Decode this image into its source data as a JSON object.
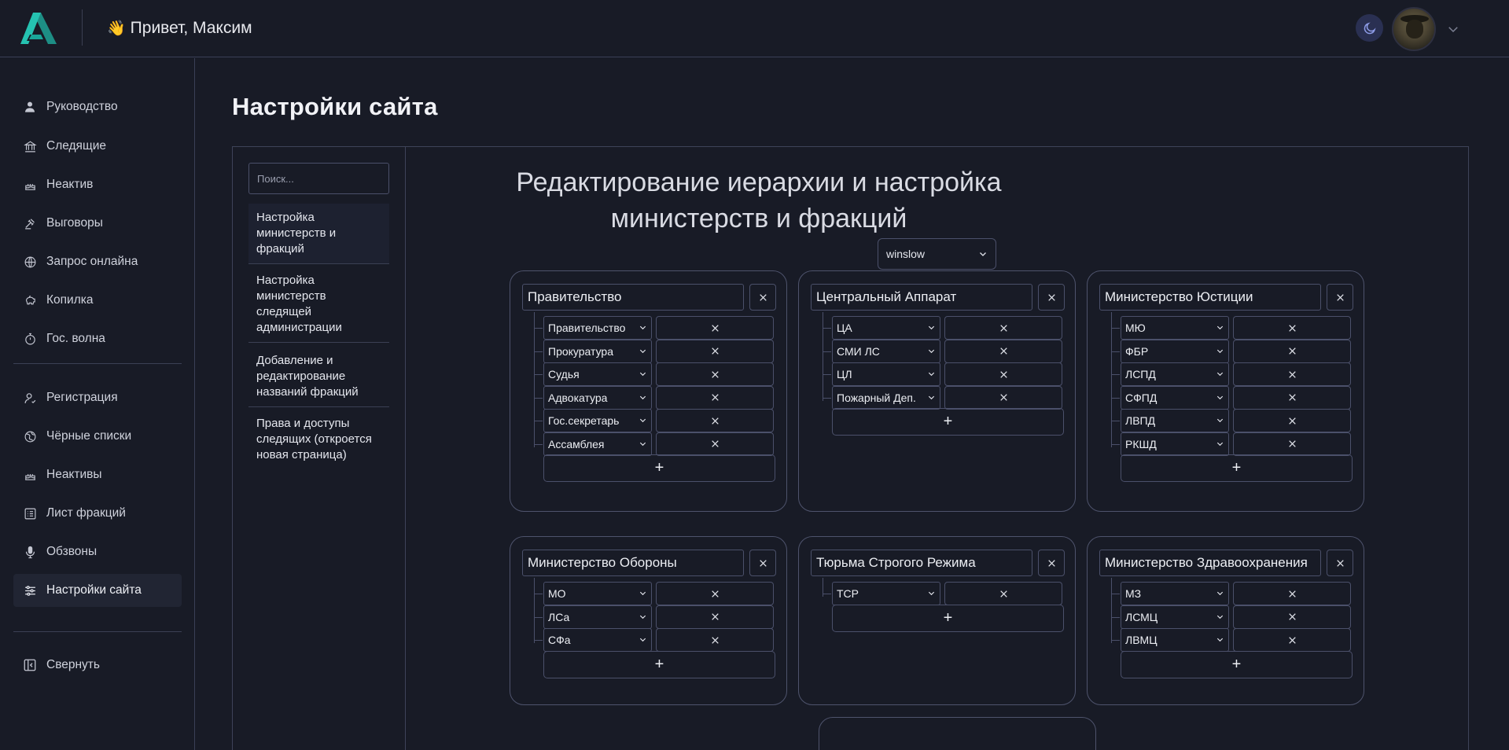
{
  "header": {
    "greeting_emoji": "👋",
    "greeting": "Привет, Максим"
  },
  "sidebar": {
    "group1": [
      {
        "label": "Руководство",
        "icon": "user-icon"
      },
      {
        "label": "Следящие",
        "icon": "bank-icon"
      },
      {
        "label": "Неактив",
        "icon": "cake-icon"
      },
      {
        "label": "Выговоры",
        "icon": "gavel-icon"
      },
      {
        "label": "Запрос онлайна",
        "icon": "globe-icon"
      },
      {
        "label": "Копилка",
        "icon": "piggy-bank-icon"
      },
      {
        "label": "Гос. волна",
        "icon": "stopwatch-icon"
      }
    ],
    "group2": [
      {
        "label": "Регистрация",
        "icon": "user-check-icon"
      },
      {
        "label": "Чёрные списки",
        "icon": "globe-alt-icon"
      },
      {
        "label": "Неактивы",
        "icon": "cake-icon"
      },
      {
        "label": "Лист фракций",
        "icon": "list-icon"
      },
      {
        "label": "Обзвоны",
        "icon": "microphone-icon"
      },
      {
        "label": "Настройки сайта",
        "icon": "sliders-icon"
      }
    ],
    "collapse": "Свернуть"
  },
  "page": {
    "title": "Настройки сайта"
  },
  "settings_menu": {
    "search_placeholder": "Поиск...",
    "items": [
      "Настройка министерств и фракций",
      "Настройка министерств следящей администрации",
      "Добавление и редактирование названий фракций",
      "Права и доступы следящих (откроется новая страница)"
    ]
  },
  "editor": {
    "title": "Редактирование иерархии и настройка министерств и фракций",
    "server": "winslow",
    "add_label": "+",
    "ministries": [
      {
        "name": "Правительство",
        "factions": [
          "Правительство",
          "Прокуратура",
          "Судья",
          "Адвокатура",
          "Гос.секретарь",
          "Ассамблея"
        ]
      },
      {
        "name": "Центральный Аппарат",
        "factions": [
          "ЦА",
          "СМИ ЛС",
          "ЦЛ",
          "Пожарный Деп."
        ]
      },
      {
        "name": "Министерство Юстиции",
        "factions": [
          "МЮ",
          "ФБР",
          "ЛСПД",
          "СФПД",
          "ЛВПД",
          "РКШД"
        ]
      },
      {
        "name": "Министерство Обороны",
        "factions": [
          "МО",
          "ЛСа",
          "СФа"
        ]
      },
      {
        "name": "Тюрьма Строгого Режима",
        "factions": [
          "ТСР"
        ]
      },
      {
        "name": "Министерство Здравоохранения",
        "factions": [
          "МЗ",
          "ЛСМЦ",
          "ЛВМЦ"
        ]
      }
    ]
  },
  "colors": {
    "background": "#181b26",
    "border": "#4b506a",
    "logo_teal": "#1fb3a4",
    "moon_bg": "#2a3052"
  }
}
